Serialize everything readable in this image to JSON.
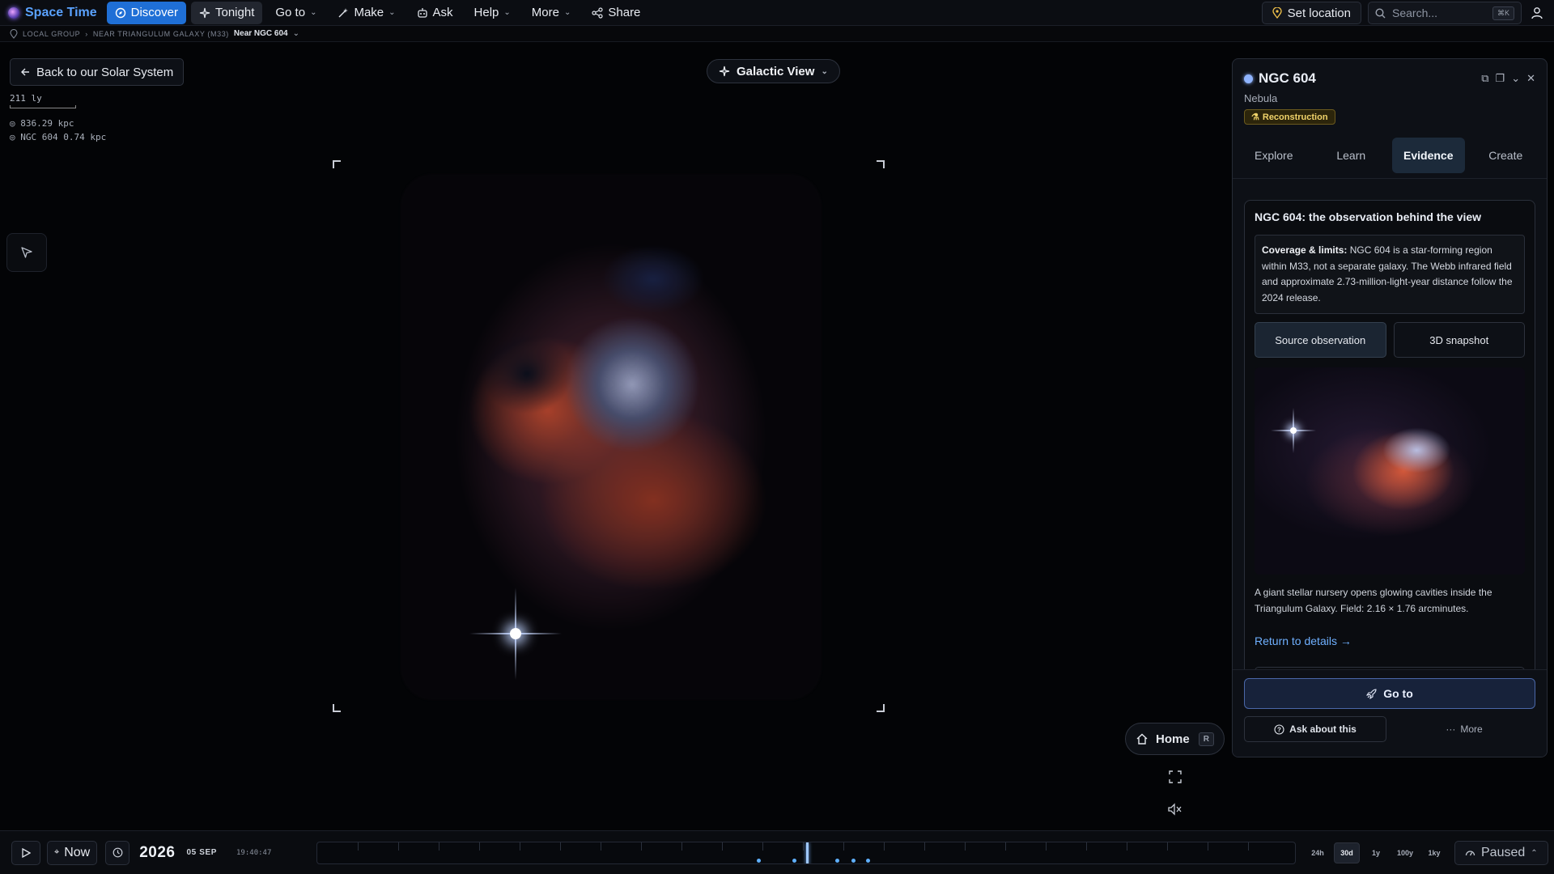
{
  "app": {
    "name": "Space Time"
  },
  "nav": {
    "discover": "Discover",
    "tonight": "Tonight",
    "goto": "Go to",
    "make": "Make",
    "ask": "Ask",
    "help": "Help",
    "more": "More",
    "share": "Share"
  },
  "toolbar": {
    "set_location": "Set location",
    "search_placeholder": "Search...",
    "search_shortcut": "⌘K"
  },
  "breadcrumb": {
    "items": [
      "LOCAL GROUP",
      "NEAR TRIANGULUM GALAXY (M33)"
    ],
    "current": "Near NGC 604"
  },
  "view": {
    "back_label": "Back to our Solar System",
    "scale_label": "211 ly",
    "readout_1": "836.29 kpc",
    "readout_2": "NGC 604 0.74 kpc",
    "mode_label": "Galactic View",
    "home_label": "Home",
    "home_shortcut": "R"
  },
  "panel": {
    "title": "NGC 604",
    "type": "Nebula",
    "badge": "Reconstruction",
    "tabs": [
      "Explore",
      "Learn",
      "Evidence",
      "Create"
    ],
    "active_tab": "Evidence",
    "evidence": {
      "heading": "NGC 604: the observation behind the view",
      "coverage_label": "Coverage & limits:",
      "coverage_text": "NGC 604 is a star-forming region within M33, not a separate galaxy. The Webb infrared field and approximate 2.73-million-light-year distance follow the 2024 release.",
      "source_btn": "Source observation",
      "snapshot_btn": "3D snapshot",
      "caption": "A giant stellar nursery opens glowing cavities inside the Triangulum Galaxy. Field: 2.16 × 1.76 arcminutes.",
      "return_link": "Return to details →"
    },
    "goto_label": "Go to",
    "ask_label": "Ask about this",
    "more_label": "More"
  },
  "timeline": {
    "now_label": "Now",
    "year": "2026",
    "date": "05 SEP",
    "time": "19:40:47",
    "ranges": [
      "24h",
      "30d",
      "1y",
      "100y",
      "1ky"
    ],
    "active_range": "30d",
    "status": "Paused"
  },
  "colors": {
    "accent": "#1f6fd6",
    "link": "#6fb0ff",
    "badge": "#f0d36a"
  }
}
